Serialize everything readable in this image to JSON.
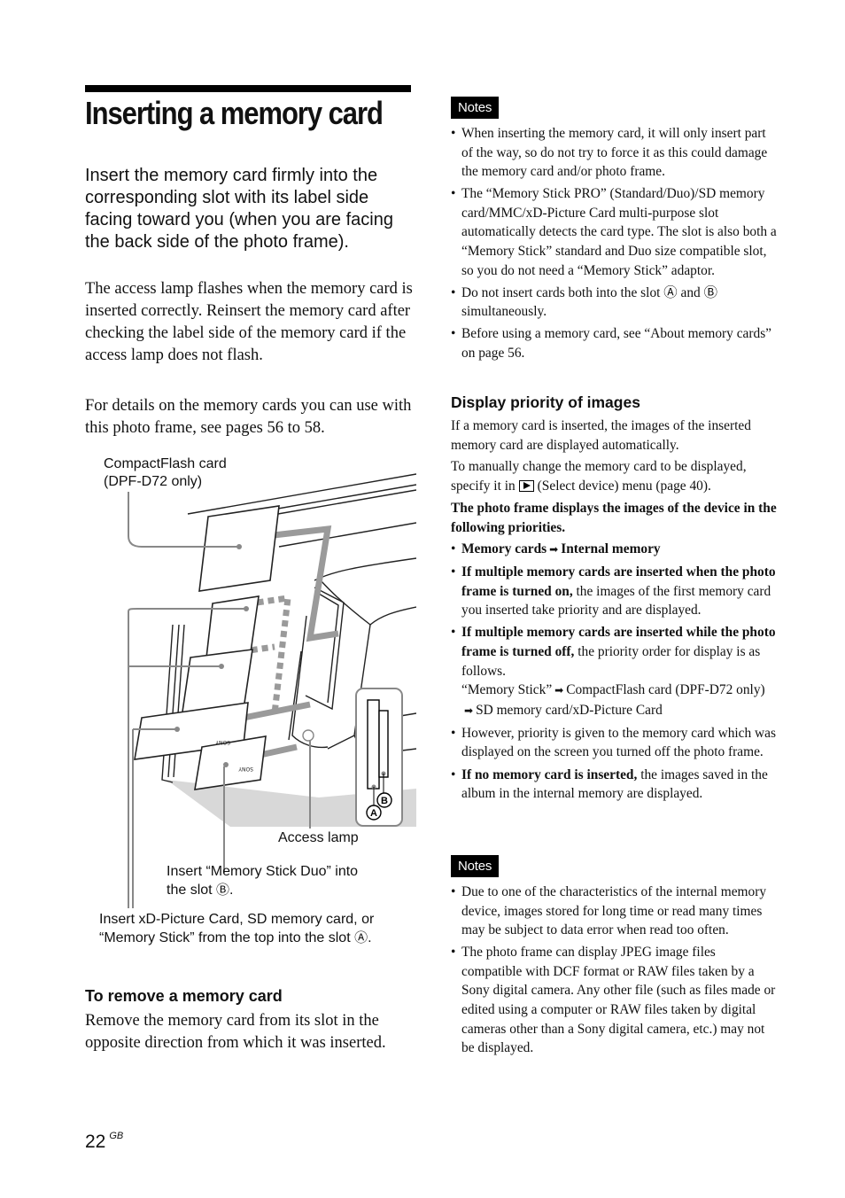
{
  "title": "Inserting a memory card",
  "intro": "Insert the memory card firmly into the corresponding slot with its label side facing toward you (when you are facing the back side of the photo frame).",
  "paragraphs": {
    "access_lamp": "The access lamp flashes when the memory card is inserted correctly. Reinsert the memory card after checking the label side of the memory card if the access lamp does not flash.",
    "details": "For details on the memory cards you can use with this photo frame, see pages 56 to 58."
  },
  "figure": {
    "label_compactflash_line1": "CompactFlash card",
    "label_compactflash_line2": "(DPF-D72 only)",
    "label_access_lamp": "Access lamp",
    "label_duo_line1": "Insert “Memory Stick Duo” into",
    "label_duo_line2_pre": "the slot ",
    "label_duo_slot": "Ⓑ",
    "label_duo_line2_post": ".",
    "label_xd_line1": "Insert  xD-Picture Card, SD memory card, or",
    "label_xd_line2_pre": "“Memory Stick” from the top into the slot ",
    "label_xd_slot": "Ⓐ",
    "label_xd_line2_post": ".",
    "slot_a": "A",
    "slot_b": "B",
    "card_brand": "SONY"
  },
  "remove": {
    "heading": "To remove a memory card",
    "text": "Remove the memory card from its slot in the opposite direction from which it was inserted."
  },
  "page_number": "22",
  "page_lang": "GB",
  "notes1": {
    "badge": "Notes",
    "items": [
      "When inserting the memory card, it will only insert part of the way, so do not try to force it as this could damage the memory card and/or photo frame.",
      "The “Memory Stick PRO” (Standard/Duo)/SD memory card/MMC/xD-Picture Card multi-purpose slot automatically detects the card type. The slot is also both a “Memory Stick” standard and Duo size compatible slot, so you do not need a “Memory Stick” adaptor.",
      "Do not insert cards both into the slot Ⓐ and Ⓑ simultaneously.",
      "Before using a memory card, see “About memory cards” on page 56."
    ]
  },
  "display_priority": {
    "heading": "Display priority of images",
    "p1": "If a memory card is inserted, the images of the inserted memory card are displayed automatically.",
    "p2_pre": "To manually change the memory card to be displayed, specify it in",
    "p2_icon": "play-icon",
    "p2_post": "(Select device) menu (page 40).",
    "p3": "The photo frame displays the images of the device in the following priorities.",
    "items": [
      {
        "bold_a": "Memory cards",
        "bold_b": "Internal memory"
      },
      {
        "bold": "If multiple memory cards are inserted when the photo frame is turned on,",
        "text": " the images of the first memory card you inserted take priority and are displayed."
      },
      {
        "bold": "If multiple memory cards are inserted while the photo frame is turned off,",
        "text": " the priority order for display is as follows.",
        "order_1": "“Memory Stick”",
        "order_2": "CompactFlash card (DPF-D72 only)",
        "order_3": "SD memory card/xD-Picture Card"
      },
      {
        "text": "However, priority is given to the memory card which was displayed on the screen you turned off the photo frame."
      },
      {
        "bold": "If no memory card is inserted,",
        "text": " the images saved in the album in the internal memory are displayed."
      }
    ]
  },
  "notes2": {
    "badge": "Notes",
    "items": [
      "Due to one of the characteristics of the internal memory device, images stored for long time or read many times may be subject to data error when read too often.",
      "The photo frame can display JPEG image files compatible with DCF format or RAW files taken by a Sony digital camera. Any other file (such as files made or edited using a computer or RAW files taken by digital cameras other than a Sony digital camera, etc.) may not be displayed."
    ]
  },
  "colors": {
    "text": "#111111",
    "badge_bg": "#000000",
    "arrow_gray": "#9a9a9a",
    "shadow_gray": "#d4d4d4"
  }
}
